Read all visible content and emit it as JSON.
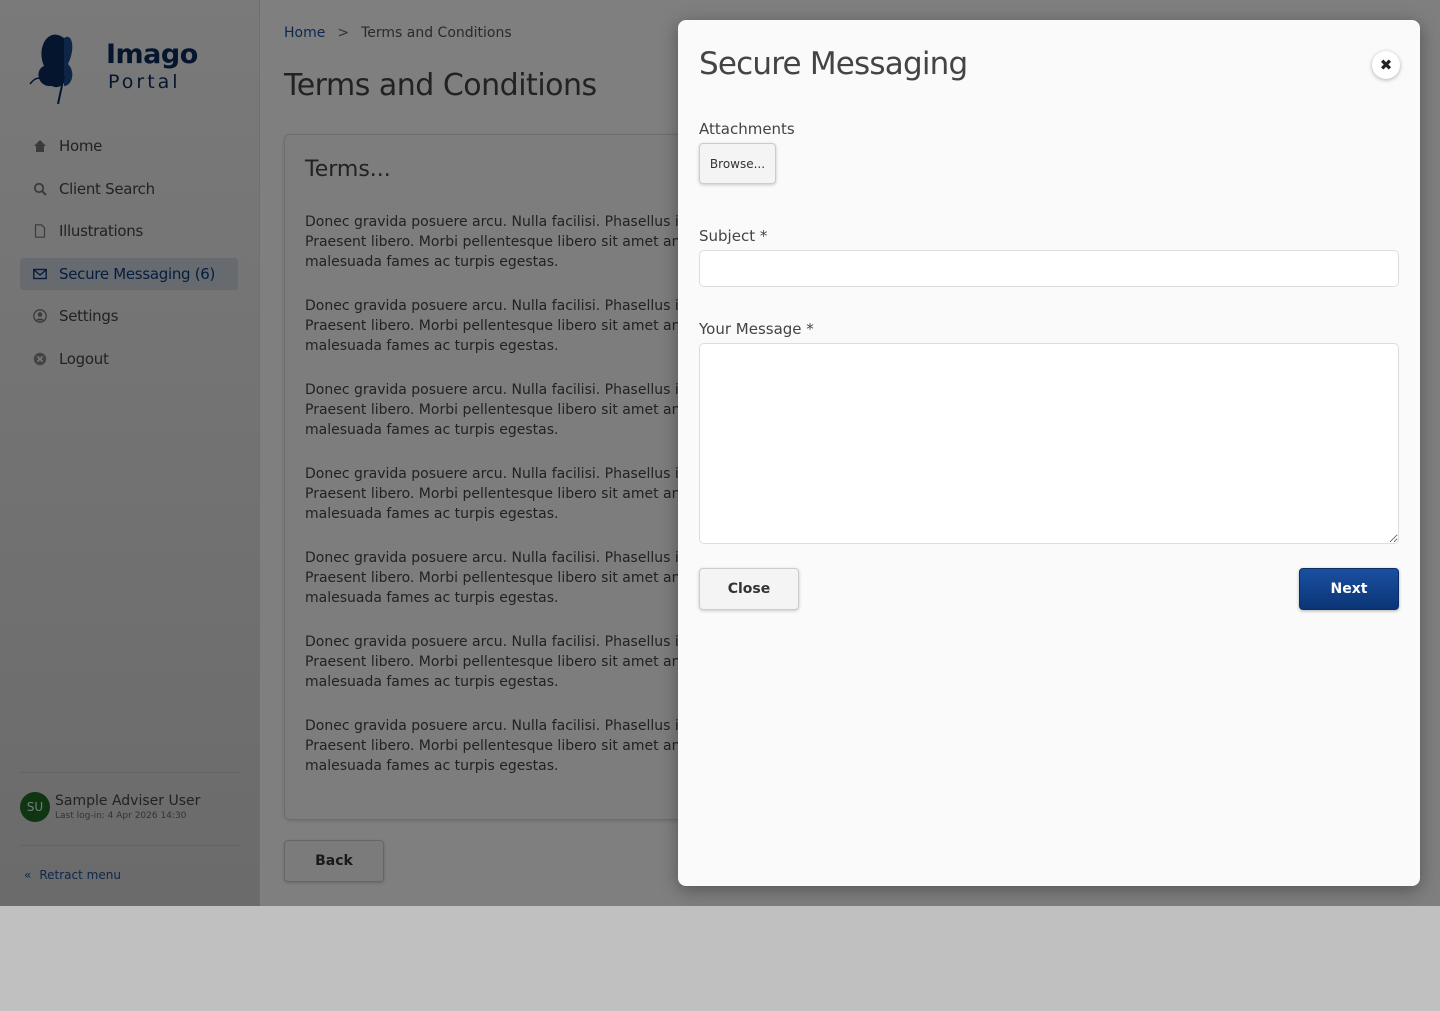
{
  "app": {
    "logo": {
      "line1": "Imago",
      "line2": "Portal",
      "icon": "butterfly-logo"
    }
  },
  "sidebar": {
    "items": [
      {
        "label": "Home",
        "icon": "home-icon",
        "active": false
      },
      {
        "label": "Client Search",
        "icon": "search-icon",
        "active": false
      },
      {
        "label": "Illustrations",
        "icon": "document-icon",
        "active": false
      },
      {
        "label": "Secure Messaging (6)",
        "icon": "envelope-icon",
        "active": true
      },
      {
        "label": "Settings",
        "icon": "user-circle-icon",
        "active": false
      },
      {
        "label": "Logout",
        "icon": "close-circle-icon",
        "active": false
      }
    ],
    "user": {
      "initials": "SU",
      "name": "Sample Adviser User",
      "last_login": "Last log-in: 4 Apr 2026 14:30"
    },
    "retract": "Retract menu"
  },
  "main": {
    "breadcrumb": {
      "home": "Home",
      "separator": ">",
      "current": "Terms and Conditions"
    },
    "title": "Terms and Conditions",
    "card_title": "Terms...",
    "paragraphs": [
      "Donec gravida posuere arcu. Nulla facilisi. Phasellus imperdiet.\nPraesent libero. Morbi pellentesque libero sit amet ante.\nmalesuada fames ac turpis egestas.",
      "Donec gravida posuere arcu. Nulla facilisi. Phasellus imperdiet.\nPraesent libero. Morbi pellentesque libero sit amet ante.\nmalesuada fames ac turpis egestas.",
      "Donec gravida posuere arcu. Nulla facilisi. Phasellus imperdiet.\nPraesent libero. Morbi pellentesque libero sit amet ante.\nmalesuada fames ac turpis egestas.",
      "Donec gravida posuere arcu. Nulla facilisi. Phasellus imperdiet.\nPraesent libero. Morbi pellentesque libero sit amet ante.\nmalesuada fames ac turpis egestas.",
      "Donec gravida posuere arcu. Nulla facilisi. Phasellus imperdiet.\nPraesent libero. Morbi pellentesque libero sit amet ante.\nmalesuada fames ac turpis egestas.",
      "Donec gravida posuere arcu. Nulla facilisi. Phasellus imperdiet.\nPraesent libero. Morbi pellentesque libero sit amet ante.\nmalesuada fames ac turpis egestas.",
      "Donec gravida posuere arcu. Nulla facilisi. Phasellus imperdiet.\nPraesent libero. Morbi pellentesque libero sit amet ante.\nmalesuada fames ac turpis egestas."
    ],
    "back_label": "Back"
  },
  "modal": {
    "title": "Secure Messaging",
    "attachments_label": "Attachments",
    "browse_label": "Browse...",
    "subject_label": "Subject *",
    "subject_value": "",
    "message_label": "Your Message *",
    "message_value": "",
    "close_label": "Close",
    "next_label": "Next"
  },
  "colors": {
    "accent": "#0b3576",
    "link": "#1d4f9a",
    "avatar": "#1f6b25"
  }
}
